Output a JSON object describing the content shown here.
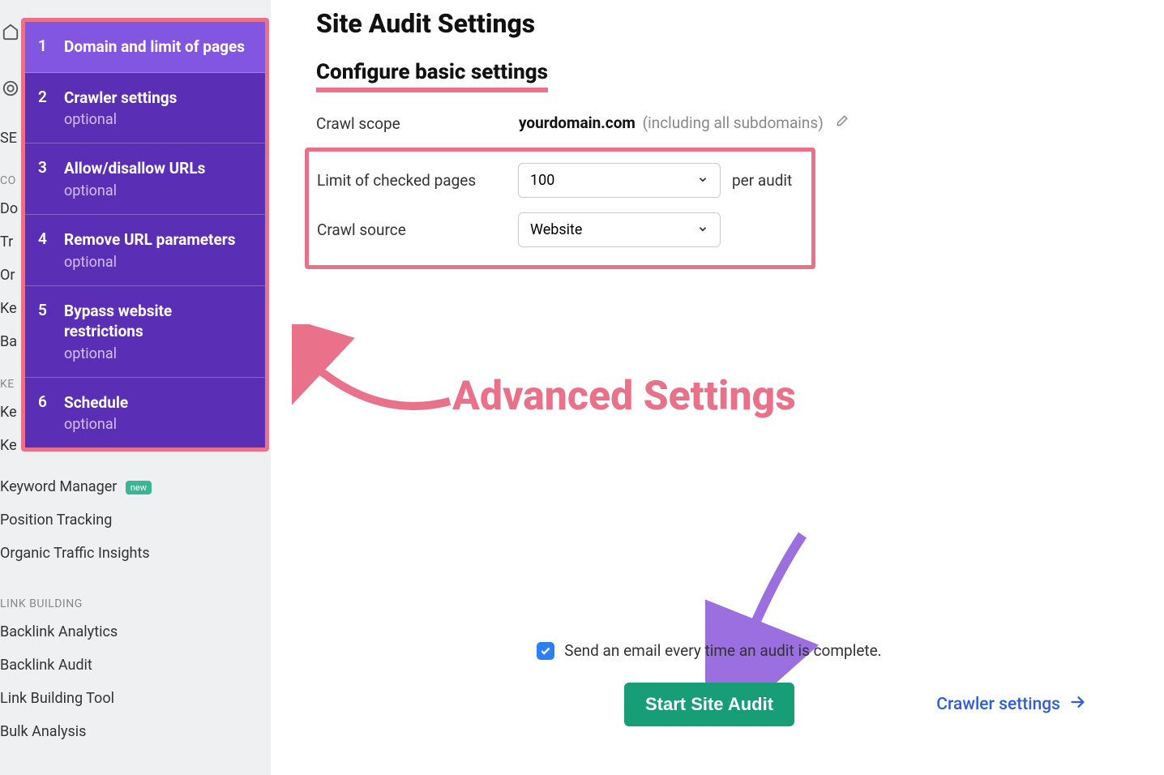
{
  "page_title": "Site Audit Settings",
  "subsection_title": "Configure basic settings",
  "wizard_steps": [
    {
      "num": "1",
      "title": "Domain and limit of pages",
      "sub": "",
      "active": true
    },
    {
      "num": "2",
      "title": "Crawler settings",
      "sub": "optional",
      "active": false
    },
    {
      "num": "3",
      "title": "Allow/disallow URLs",
      "sub": "optional",
      "active": false
    },
    {
      "num": "4",
      "title": "Remove URL parameters",
      "sub": "optional",
      "active": false
    },
    {
      "num": "5",
      "title": "Bypass website restrictions",
      "sub": "optional",
      "active": false
    },
    {
      "num": "6",
      "title": "Schedule",
      "sub": "optional",
      "active": false
    }
  ],
  "crawl_scope": {
    "label": "Crawl scope",
    "domain": "yourdomain.com",
    "suffix": "(including all subdomains)"
  },
  "limit_pages": {
    "label": "Limit of checked pages",
    "value": "100",
    "suffix": "per audit"
  },
  "crawl_source": {
    "label": "Crawl source",
    "value": "Website"
  },
  "annotation": "Advanced Settings",
  "email_checkbox": {
    "checked": true,
    "label": "Send an email every time an audit is complete."
  },
  "start_button": "Start Site Audit",
  "next_link": "Crawler settings",
  "bg_nav": {
    "top": [
      "SE",
      "CO",
      "Do",
      "Tr",
      "Or",
      "Ke",
      "Ba",
      "KE",
      "Ke",
      "Ke"
    ],
    "keyword_manager": "Keyword Manager",
    "new_badge": "new",
    "position_tracking": "Position Tracking",
    "organic_insights": "Organic Traffic Insights",
    "link_building_section": "LINK BUILDING",
    "backlink_analytics": "Backlink Analytics",
    "backlink_audit": "Backlink Audit",
    "link_building_tool": "Link Building Tool",
    "bulk_analysis": "Bulk Analysis"
  }
}
